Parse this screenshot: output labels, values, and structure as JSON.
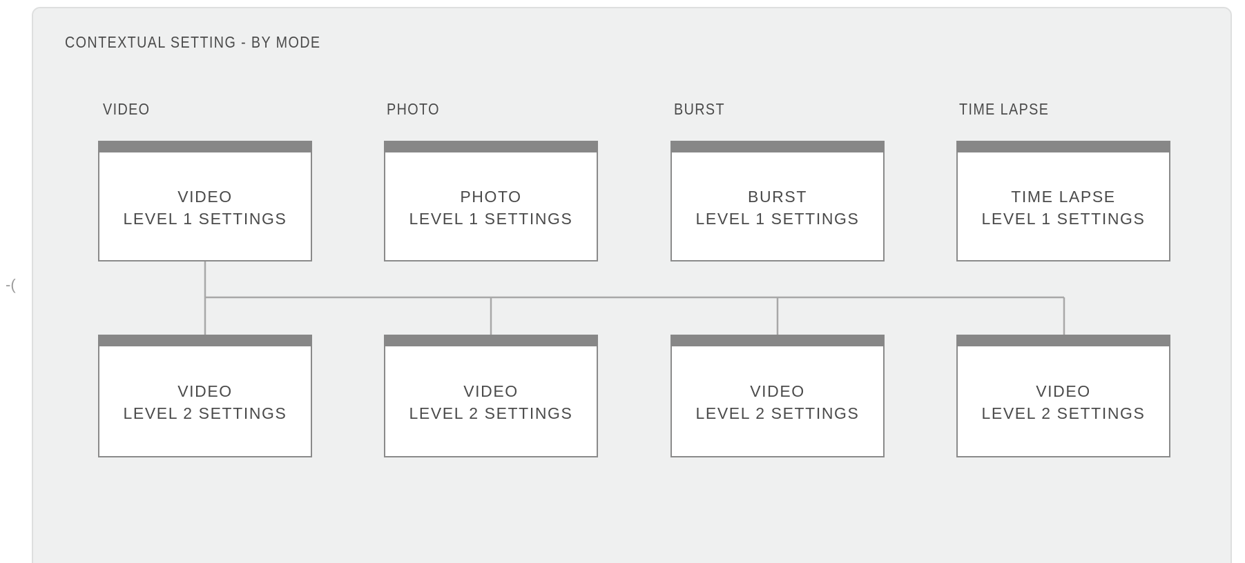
{
  "diagram": {
    "title": "CONTEXTUAL SETTING - BY MODE",
    "edge_glyph": "-(",
    "columns": [
      {
        "label": "VIDEO",
        "level1": {
          "line1": "VIDEO",
          "line2": "LEVEL 1 SETTINGS"
        },
        "level2": {
          "line1": "VIDEO",
          "line2": "LEVEL 2 SETTINGS"
        }
      },
      {
        "label": "PHOTO",
        "level1": {
          "line1": "PHOTO",
          "line2": "LEVEL 1 SETTINGS"
        },
        "level2": {
          "line1": "VIDEO",
          "line2": "LEVEL 2 SETTINGS"
        }
      },
      {
        "label": "BURST",
        "level1": {
          "line1": "BURST",
          "line2": "LEVEL 1 SETTINGS"
        },
        "level2": {
          "line1": "VIDEO",
          "line2": "LEVEL 2 SETTINGS"
        }
      },
      {
        "label": "TIME LAPSE",
        "level1": {
          "line1": "TIME LAPSE",
          "line2": "LEVEL 1 SETTINGS"
        },
        "level2": {
          "line1": "VIDEO",
          "line2": "LEVEL 2 SETTINGS"
        }
      }
    ],
    "colors": {
      "panel_background": "#eff0f0",
      "panel_border": "#dedfdf",
      "box_header_bar": "#878787",
      "box_border": "#8a8a8a",
      "connector": "#a8a8a8",
      "text": "#4a4a4a"
    }
  }
}
